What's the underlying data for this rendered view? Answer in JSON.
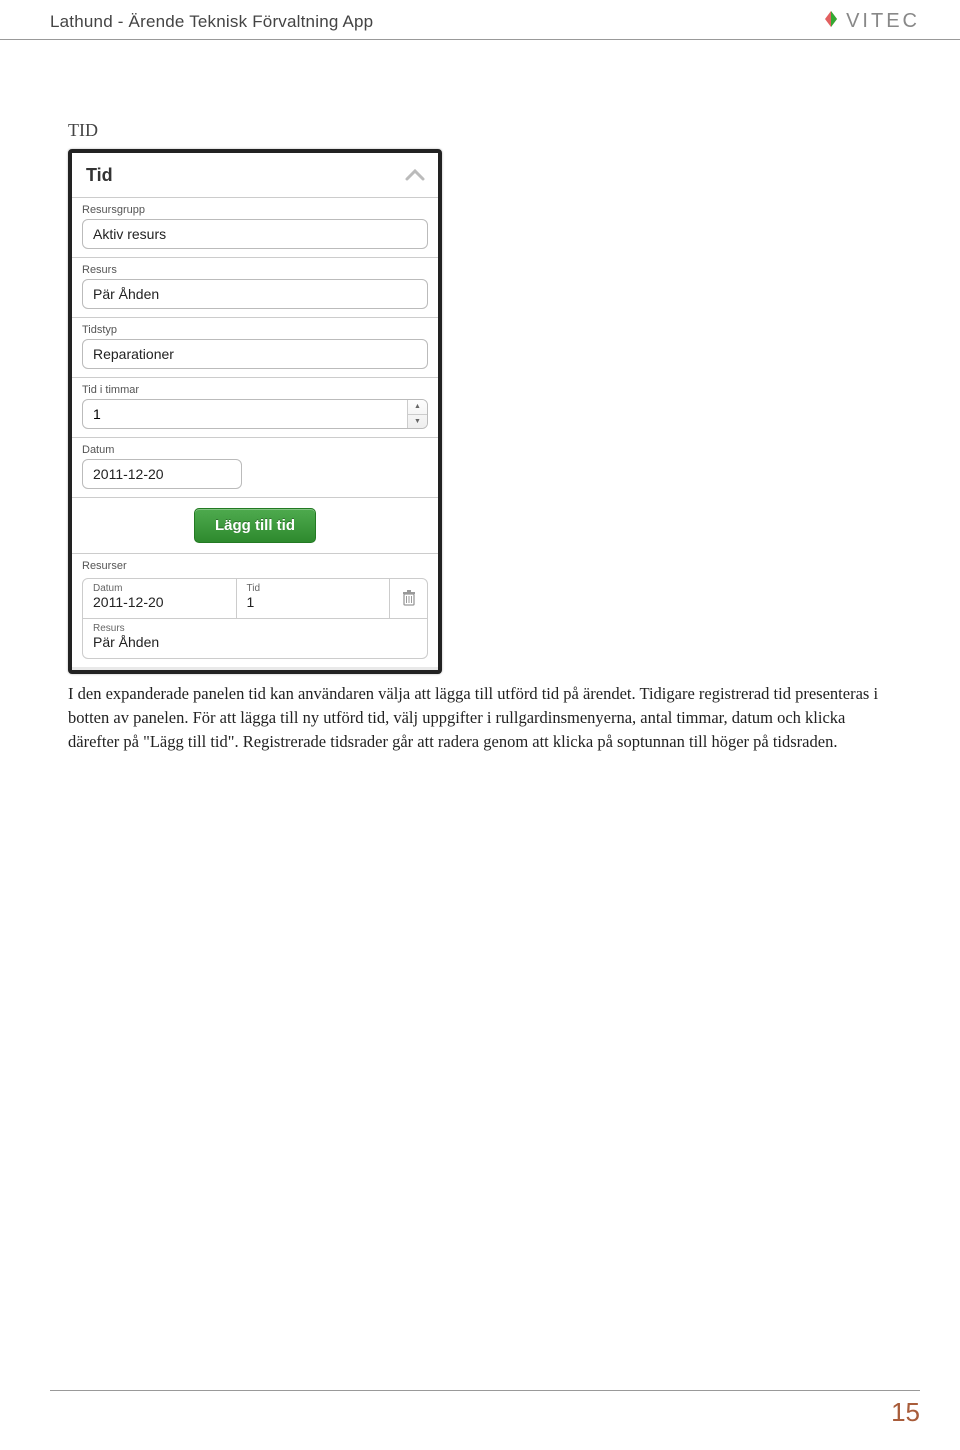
{
  "header": {
    "title": "Lathund - Ärende Teknisk Förvaltning App",
    "brand": "VITEC"
  },
  "section": {
    "heading": "TID"
  },
  "panel": {
    "title": "Tid",
    "fields": {
      "resursgrupp": {
        "label": "Resursgrupp",
        "value": "Aktiv resurs"
      },
      "resurs": {
        "label": "Resurs",
        "value": "Pär Åhden"
      },
      "tidstyp": {
        "label": "Tidstyp",
        "value": "Reparationer"
      },
      "timmar": {
        "label": "Tid i timmar",
        "value": "1"
      },
      "datum": {
        "label": "Datum",
        "value": "2011-12-20"
      }
    },
    "add_button": "Lägg till tid",
    "resources": {
      "title": "Resurser",
      "datum_label": "Datum",
      "datum_value": "2011-12-20",
      "tid_label": "Tid",
      "tid_value": "1",
      "resurs_label": "Resurs",
      "resurs_value": "Pär Åhden"
    }
  },
  "body_text": "I den expanderade panelen tid kan användaren välja att lägga till utförd tid på ärendet. Tidigare registrerad tid presenteras i botten av panelen. För att lägga till ny utförd tid, välj uppgifter i rullgardinsmenyerna, antal timmar, datum och klicka därefter på \"Lägg till tid\". Registrerade tidsrader går att radera genom att klicka på soptunnan till höger på tidsraden.",
  "footer": {
    "page_number": "15"
  }
}
